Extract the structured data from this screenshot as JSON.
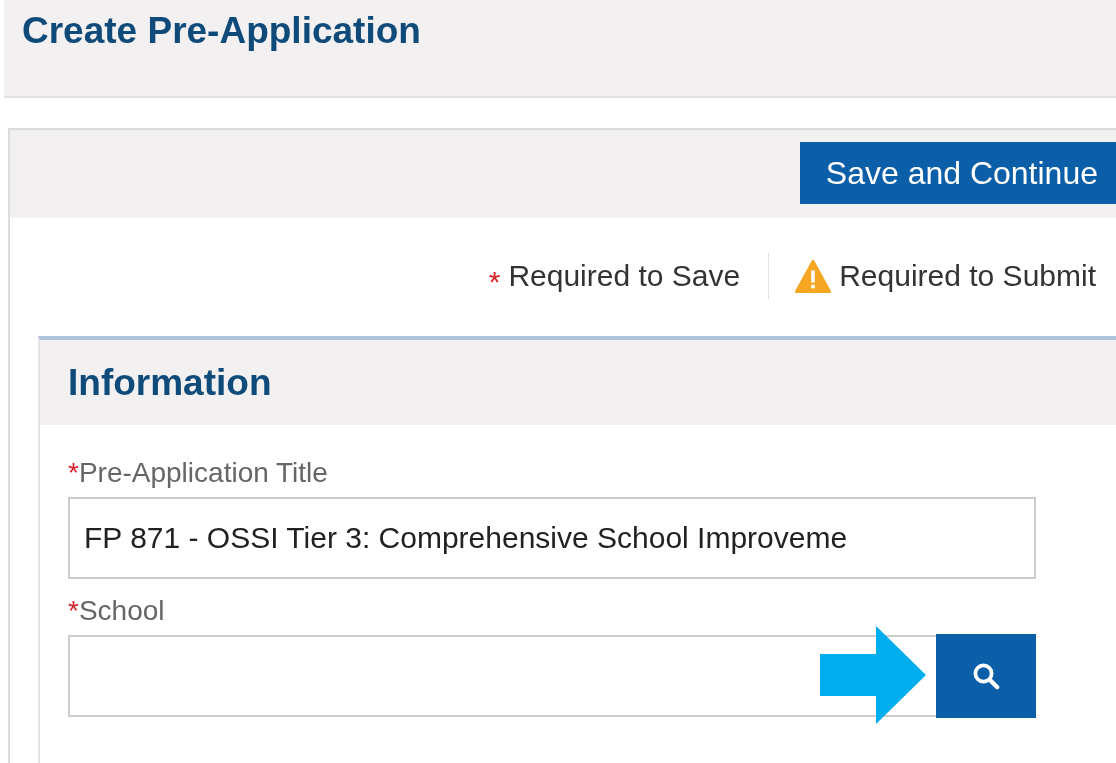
{
  "page_title": "Create Pre-Application",
  "toolbar": {
    "save_button": "Save and Continue"
  },
  "legend": [
    {
      "kind": "asterisk",
      "marker": "*",
      "label": "Required to Save"
    },
    {
      "kind": "warning",
      "label": "Required to Submit"
    }
  ],
  "section": {
    "title": "Information",
    "fields": [
      {
        "kind": "text",
        "required_mark": "*",
        "label": "Pre-Application Title",
        "value": "FP 871 - OSSI Tier 3: Comprehensive School Improveme"
      },
      {
        "kind": "lookup",
        "required_mark": "*",
        "label": "School",
        "callout_arrow": true
      }
    ]
  }
}
